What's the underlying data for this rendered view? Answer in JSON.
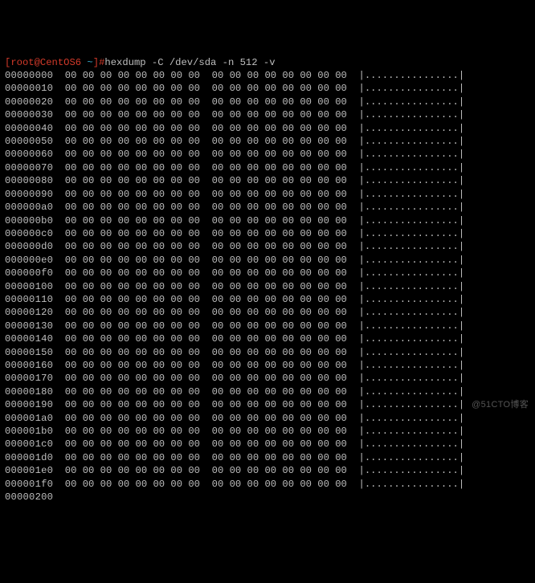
{
  "prompt": {
    "open_bracket": "[",
    "user_host": "root@CentOS6",
    "space1": " ",
    "cwd": "~",
    "close_bracket": "]",
    "hash": "#"
  },
  "command": "hexdump -C /dev/sda -n 512 -v",
  "hex_row": {
    "group": "00 00 00 00 00 00 00 00",
    "gap": "  ",
    "ascii_open": "|",
    "ascii_dots": "................",
    "ascii_close": "|"
  },
  "offsets": [
    "00000000",
    "00000010",
    "00000020",
    "00000030",
    "00000040",
    "00000050",
    "00000060",
    "00000070",
    "00000080",
    "00000090",
    "000000a0",
    "000000b0",
    "000000c0",
    "000000d0",
    "000000e0",
    "000000f0",
    "00000100",
    "00000110",
    "00000120",
    "00000130",
    "00000140",
    "00000150",
    "00000160",
    "00000170",
    "00000180",
    "00000190",
    "000001a0",
    "000001b0",
    "000001c0",
    "000001d0",
    "000001e0",
    "000001f0"
  ],
  "final_offset": "00000200",
  "watermark": "@51CTO博客"
}
